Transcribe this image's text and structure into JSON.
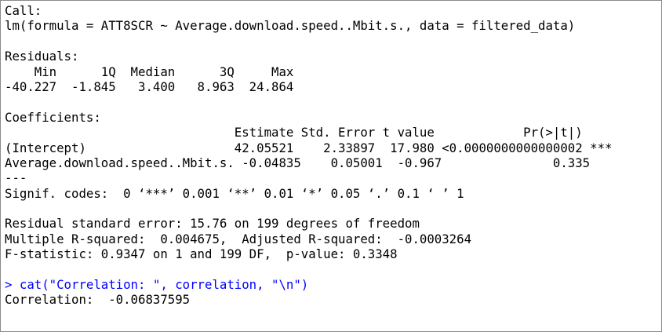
{
  "console": {
    "lines": [
      {
        "text": "Call:",
        "kind": "output"
      },
      {
        "text": "lm(formula = ATT8SCR ~ Average.download.speed..Mbit.s., data = filtered_data)",
        "kind": "output"
      },
      {
        "text": "",
        "kind": "blank"
      },
      {
        "text": "Residuals:",
        "kind": "output"
      },
      {
        "text": "    Min      1Q  Median      3Q     Max ",
        "kind": "output"
      },
      {
        "text": "-40.227  -1.845   3.400   8.963  24.864 ",
        "kind": "output"
      },
      {
        "text": "",
        "kind": "blank"
      },
      {
        "text": "Coefficients:",
        "kind": "output"
      },
      {
        "text": "                               Estimate Std. Error t value            Pr(>|t|)    ",
        "kind": "output"
      },
      {
        "text": "(Intercept)                    42.05521    2.33897  17.980 <0.0000000000000002 ***",
        "kind": "output"
      },
      {
        "text": "Average.download.speed..Mbit.s. -0.04835    0.05001  -0.967               0.335    ",
        "kind": "output"
      },
      {
        "text": "---",
        "kind": "output"
      },
      {
        "text": "Signif. codes:  0 ‘***’ 0.001 ‘**’ 0.01 ‘*’ 0.05 ‘.’ 0.1 ‘ ’ 1",
        "kind": "output"
      },
      {
        "text": "",
        "kind": "blank"
      },
      {
        "text": "Residual standard error: 15.76 on 199 degrees of freedom",
        "kind": "output"
      },
      {
        "text": "Multiple R-squared:  0.004675,\tAdjusted R-squared:  -0.0003264 ",
        "kind": "output"
      },
      {
        "text": "F-statistic: 0.9347 on 1 and 199 DF,  p-value: 0.3348",
        "kind": "output"
      },
      {
        "text": "",
        "kind": "blank"
      },
      {
        "text": "> cat(\"Correlation: \", correlation, \"\\n\")",
        "kind": "input"
      },
      {
        "text": "Correlation:  -0.06837595 ",
        "kind": "output"
      }
    ],
    "colors": {
      "output_text": "#000000",
      "input_text": "#0000ff",
      "background": "#ffffff",
      "border": "#8a8a8a"
    }
  }
}
